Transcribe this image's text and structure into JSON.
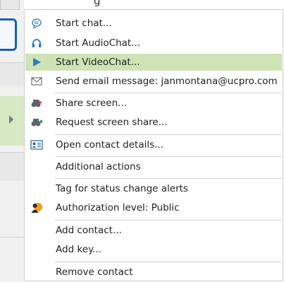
{
  "title_fragment": "g",
  "menu": {
    "items": [
      {
        "id": "start-chat",
        "label": "Start chat...",
        "icon": "chat-bubble-icon"
      },
      {
        "id": "start-audiochat",
        "label": "Start AudioChat...",
        "icon": "headset-icon"
      },
      {
        "id": "start-videochat",
        "label": "Start VideoChat...",
        "icon": "play-video-icon",
        "highlighted": true
      },
      {
        "id": "send-email",
        "label": "Send email message: janmontana@ucpro.com",
        "icon": "envelope-icon"
      },
      {
        "id": "share-screen",
        "label": "Share screen...",
        "icon": "binoculars-share-icon"
      },
      {
        "id": "request-screen-share",
        "label": "Request screen share...",
        "icon": "binoculars-request-icon"
      },
      {
        "id": "open-contact-details",
        "label": "Open contact details...",
        "icon": "contact-card-icon"
      },
      {
        "id": "additional-actions",
        "label": "Additional actions"
      },
      {
        "id": "tag-status-alerts",
        "label": "Tag for status change alerts"
      },
      {
        "id": "authorization-level",
        "label": "Authorization level: Public",
        "icon": "user-authorization-icon"
      },
      {
        "id": "add-contact",
        "label": "Add contact..."
      },
      {
        "id": "add-key",
        "label": "Add key..."
      },
      {
        "id": "remove-contact",
        "label": "Remove contact"
      }
    ]
  },
  "colors": {
    "highlight": "#cfe3b5",
    "icon_blue": "#2b7bc4",
    "background_green": "#d7e8c5",
    "selection_border_blue": "#1a62a8"
  }
}
